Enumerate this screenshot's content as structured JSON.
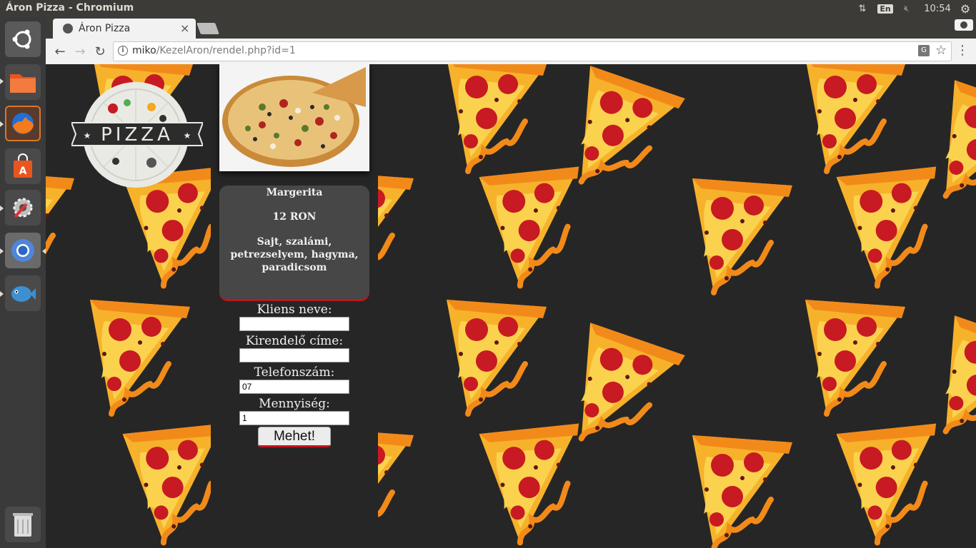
{
  "window": {
    "title": "Áron Pizza - Chromium"
  },
  "panel": {
    "keyboard_layout": "En",
    "clock": "10:54"
  },
  "launcher": {
    "items": [
      "ubuntu-dash",
      "files",
      "firefox",
      "software-center",
      "system-settings",
      "chromium",
      "bluefish",
      "trash"
    ]
  },
  "browser": {
    "tab_title": "Áron Pizza",
    "tab_close": "×",
    "url_host": "miko",
    "url_path": "/KezelAron/rendel.php?id=1"
  },
  "product": {
    "name": "Margerita",
    "price": "12 RON",
    "description": "Sajt, szalámi, petrezselyem, hagyma, paradicsom"
  },
  "logo": {
    "text": "PIZZA"
  },
  "form": {
    "name_label": "Kliens neve:",
    "name_value": "",
    "address_label": "Kirendelő címe:",
    "address_value": "",
    "phone_label": "Telefonszám:",
    "phone_value": "07",
    "quantity_label": "Mennyiség:",
    "quantity_value": "1",
    "submit_label": "Mehet!"
  },
  "colors": {
    "page_bg": "#262626",
    "card_bg": "#474747",
    "accent_red": "#c0161b",
    "pizza_crust": "#f5a623",
    "pepperoni": "#d0202a"
  }
}
